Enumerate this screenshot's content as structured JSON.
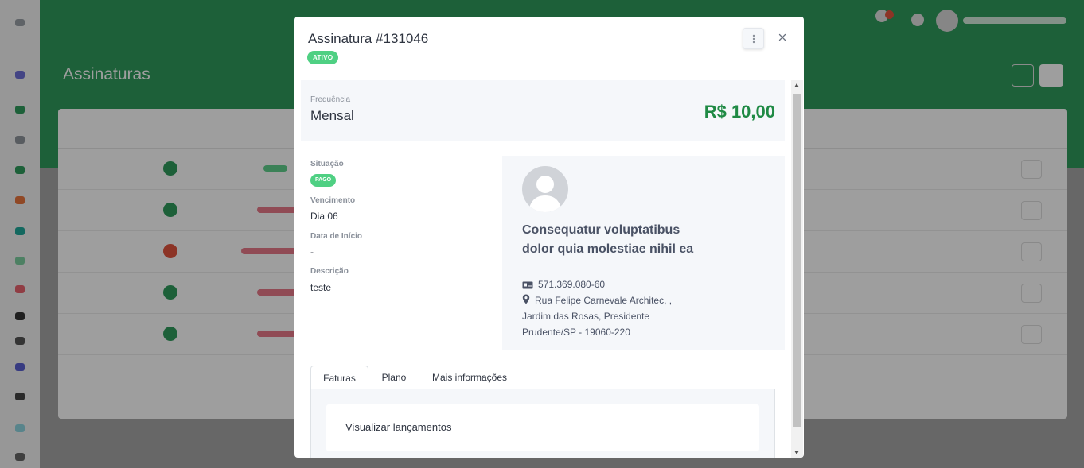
{
  "background": {
    "page_title": "Assinaturas"
  },
  "modal": {
    "title": "Assinatura #131046",
    "status_badge": "ATIVO",
    "frequency_label": "Frequência",
    "frequency_value": "Mensal",
    "price": "R$ 10,00",
    "fields": {
      "situacao_label": "Situação",
      "situacao_badge": "PAGO",
      "vencimento_label": "Vencimento",
      "vencimento_value": "Dia 06",
      "data_inicio_label": "Data de Início",
      "data_inicio_value": "-",
      "descricao_label": "Descrição",
      "descricao_value": "teste"
    },
    "customer": {
      "name": "Consequatur voluptatibus dolor quia molestiae nihil ea",
      "document": "571.369.080-60",
      "address": "Rua Felipe Carnevale Architec, , Jardim das Rosas, Presidente Prudente/SP - 19060-220"
    },
    "tabs": [
      {
        "label": "Faturas"
      },
      {
        "label": "Plano"
      },
      {
        "label": "Mais informações"
      }
    ],
    "panel_action": "Visualizar lançamentos"
  },
  "colors": {
    "accent_green": "#2f9b5c",
    "badge_green": "#4fd083",
    "price_green": "#1f8a44"
  },
  "icons": {
    "close": "close-icon",
    "more": "kebab-vertical-icon",
    "document": "id-card-icon",
    "address": "map-pin-icon"
  }
}
